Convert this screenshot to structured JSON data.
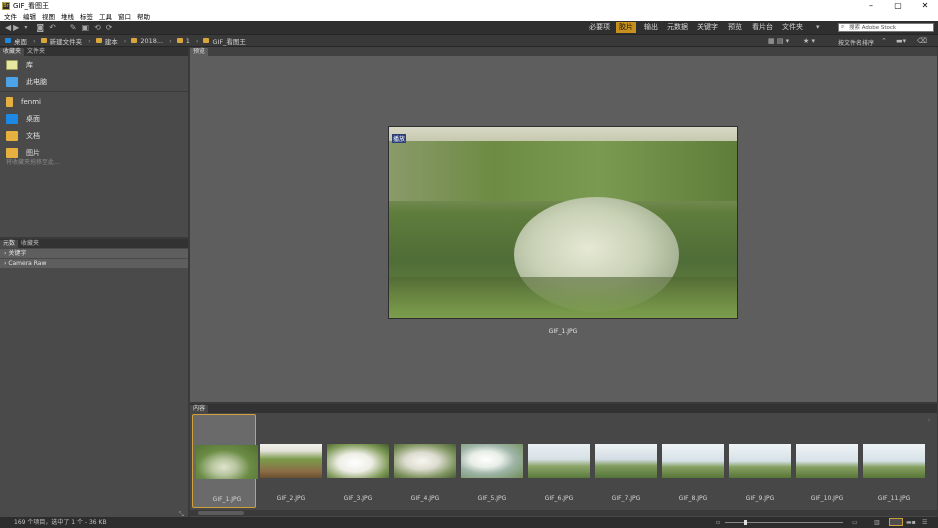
{
  "window": {
    "title": "GIF_看图王",
    "app_icon": "Br",
    "minimize": "–",
    "maximize": "▢",
    "close": "✕"
  },
  "menu": [
    "文件",
    "编辑",
    "视图",
    "堆栈",
    "标签",
    "工具",
    "窗口",
    "帮助"
  ],
  "toolbar": {
    "icons": [
      "back-icon",
      "forward-icon",
      "down-icon",
      "camera-icon",
      "boomerang-icon",
      "refine-icon",
      "open-icon",
      "rotate-left-icon",
      "rotate-right-icon"
    ]
  },
  "workspaces": [
    {
      "label": "必要项",
      "active": false
    },
    {
      "label": "胶片",
      "active": true
    },
    {
      "label": "输出",
      "active": false
    },
    {
      "label": "元数据",
      "active": false
    },
    {
      "label": "关键字",
      "active": false
    },
    {
      "label": "预览",
      "active": false
    },
    {
      "label": "看片台",
      "active": false
    },
    {
      "label": "文件夹",
      "active": false
    }
  ],
  "search": {
    "placeholder": "搜索 Adobe Stock"
  },
  "path": [
    "桌面",
    "新建文件夹",
    "建本",
    "2018...",
    "1",
    "GIF_看图王"
  ],
  "sort": {
    "label": "按文件名排序"
  },
  "left": {
    "tabs": [
      "收藏夹",
      "文件夹"
    ],
    "favorites": [
      {
        "label": "库",
        "color": "#e8e8a0"
      },
      {
        "label": "此电脑",
        "color": "#4da3e8"
      },
      {
        "label": "fenmi",
        "color": "#e5b040"
      },
      {
        "label": "桌面",
        "color": "#1e88e5"
      },
      {
        "label": "文档",
        "color": "#e5b040"
      },
      {
        "label": "图片",
        "color": "#e5b040"
      }
    ],
    "hint": "将收藏夹拖移至此..."
  },
  "metadata": {
    "tabs": [
      "元数",
      "收藏夹"
    ],
    "rows": [
      "关键字",
      "Camera Raw"
    ]
  },
  "preview": {
    "tab": "预览",
    "overlay": "播放",
    "filename": "GIF_1.JPG"
  },
  "filmstrip": {
    "tab": "内容",
    "items": [
      "GIF_1.JPG",
      "GIF_2.JPG",
      "GIF_3.JPG",
      "GIF_4.JPG",
      "GIF_5.JPG",
      "GIF_6.JPG",
      "GIF_7.JPG",
      "GIF_8.JPG",
      "GIF_9.JPG",
      "GIF_10.JPG",
      "GIF_11.JPG"
    ]
  },
  "status": {
    "text": "169 个项目，选中了 1 个 - 36 KB"
  }
}
